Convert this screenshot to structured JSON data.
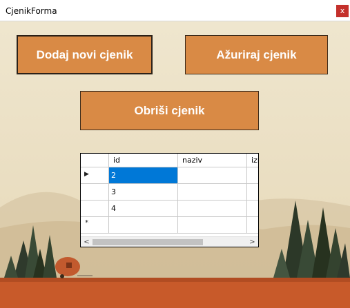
{
  "window": {
    "title": "CjenikForma",
    "close_label": "x"
  },
  "buttons": {
    "add": "Dodaj novi cjenik",
    "update": "Ažuriraj cjenik",
    "delete": "Obriši cjenik"
  },
  "grid": {
    "columns": [
      "id",
      "naziv",
      "izn"
    ],
    "rows": [
      {
        "id": "2",
        "naziv": "",
        "izn": ""
      },
      {
        "id": "3",
        "naziv": "",
        "izn": ""
      },
      {
        "id": "4",
        "naziv": "",
        "izn": ""
      }
    ],
    "current_row_indicator": "▶",
    "new_row_indicator": "*",
    "scroll_left": "<",
    "scroll_right": ">"
  },
  "colors": {
    "button_fill": "#d98a45",
    "button_border": "#3b2a1a",
    "selected_cell": "#0078d7",
    "close_button": "#c4302b",
    "ground": "#c85a2a"
  }
}
